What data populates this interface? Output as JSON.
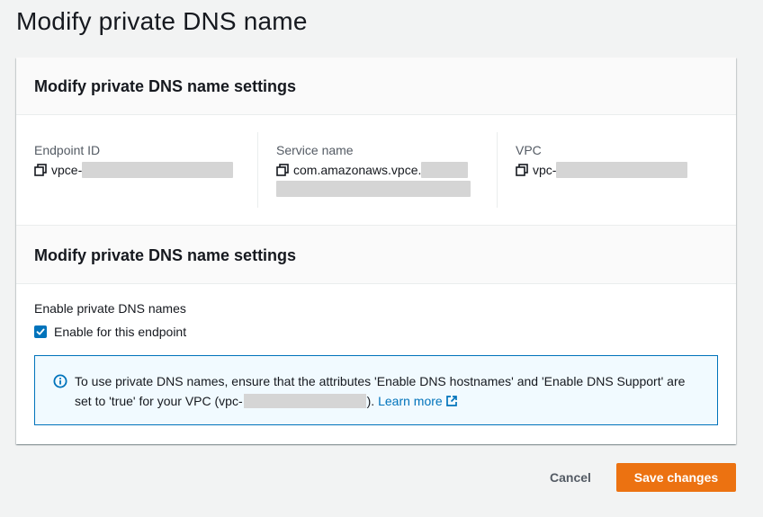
{
  "page": {
    "title": "Modify private DNS name"
  },
  "details_section": {
    "title": "Modify private DNS name settings",
    "endpoint_id": {
      "label": "Endpoint ID",
      "value": "vpce-",
      "icon": "copy-icon"
    },
    "service_name": {
      "label": "Service name",
      "value": "com.amazonaws.vpce.",
      "icon": "copy-icon"
    },
    "vpc": {
      "label": "VPC",
      "value": "vpc-",
      "icon": "copy-icon"
    }
  },
  "settings_section": {
    "title": "Modify private DNS name settings",
    "field_label": "Enable private DNS names",
    "checkbox": {
      "label": "Enable for this endpoint",
      "checked": true
    },
    "info": {
      "icon": "info-icon",
      "text_before": "To use private DNS names, ensure that the attributes 'Enable DNS hostnames' and 'Enable DNS Support' are set to 'true' for your VPC (vpc-",
      "text_after": "). ",
      "link_label": "Learn more",
      "link_icon": "external-link-icon"
    }
  },
  "actions": {
    "cancel_label": "Cancel",
    "save_label": "Save changes"
  },
  "colors": {
    "primary_button": "#ec7211",
    "link": "#0073bb",
    "info_border": "#0073bb",
    "info_background": "#f1faff",
    "page_background": "#f2f3f3"
  }
}
